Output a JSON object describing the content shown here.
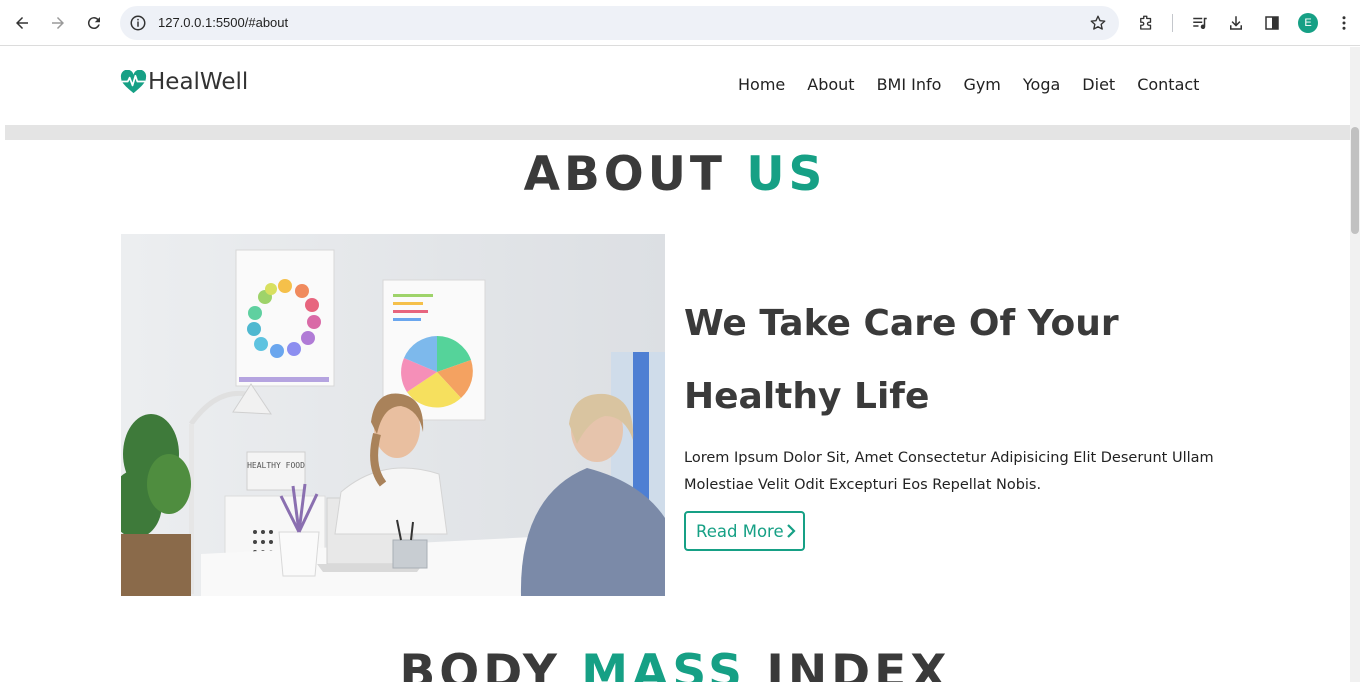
{
  "browser": {
    "url": "127.0.0.1:5500/#about",
    "profile_initial": "E",
    "icons": [
      "back-arrow-icon",
      "forward-arrow-icon",
      "reload-icon",
      "info-icon",
      "star-icon",
      "extensions-icon",
      "media-icon",
      "download-icon",
      "side-panel-icon",
      "menu-dots-icon"
    ]
  },
  "site": {
    "logo_text": "HealWell",
    "nav": [
      "Home",
      "About",
      "BMI Info",
      "Gym",
      "Yoga",
      "Diet",
      "Contact"
    ]
  },
  "about": {
    "heading_main": "ABOUT ",
    "heading_accent": "US",
    "title": "We Take Care Of Your Healthy Life",
    "text": "Lorem Ipsum Dolor Sit, Amet Consectetur Adipisicing Elit Deserunt Ullam Molestiae Velit Odit Excepturi Eos Repellat Nobis.",
    "button": "Read More",
    "image_sign_text": "HEALTHY FOOD"
  },
  "bmi": {
    "heading_part1": "BODY ",
    "heading_accent": "MASS",
    "heading_part2": " INDEX"
  },
  "colors": {
    "accent": "#16a085",
    "text_dark": "#3a3a3a",
    "band_gray": "#e4e4e4"
  }
}
